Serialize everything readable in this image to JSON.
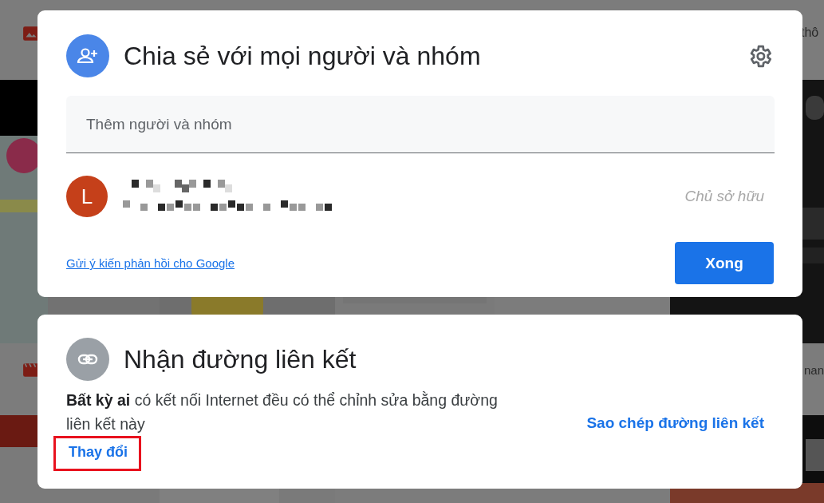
{
  "background": {
    "file_names": [
      {
        "text": "thô"
      },
      {
        "text": "nan"
      }
    ]
  },
  "share_dialog": {
    "title": "Chia sẻ với mọi người và nhóm",
    "add_field": {
      "placeholder": "Thêm người và nhóm"
    },
    "people": [
      {
        "avatar_letter": "L",
        "color": "#c5401a",
        "role": "Chủ sở hữu"
      }
    ],
    "feedback_link": "Gửi ý kiến phản hồi cho Google",
    "done_button": "Xong"
  },
  "link_dialog": {
    "title": "Nhận đường liên kết",
    "description": "**Bất kỳ ai** có kết nối Internet đều có thể chỉnh sửa bằng đường liên kết này",
    "change_link": {
      "text": "Thay đổi",
      "highlighted": true
    },
    "copy_link": "Sao chép đường liên kết"
  }
}
